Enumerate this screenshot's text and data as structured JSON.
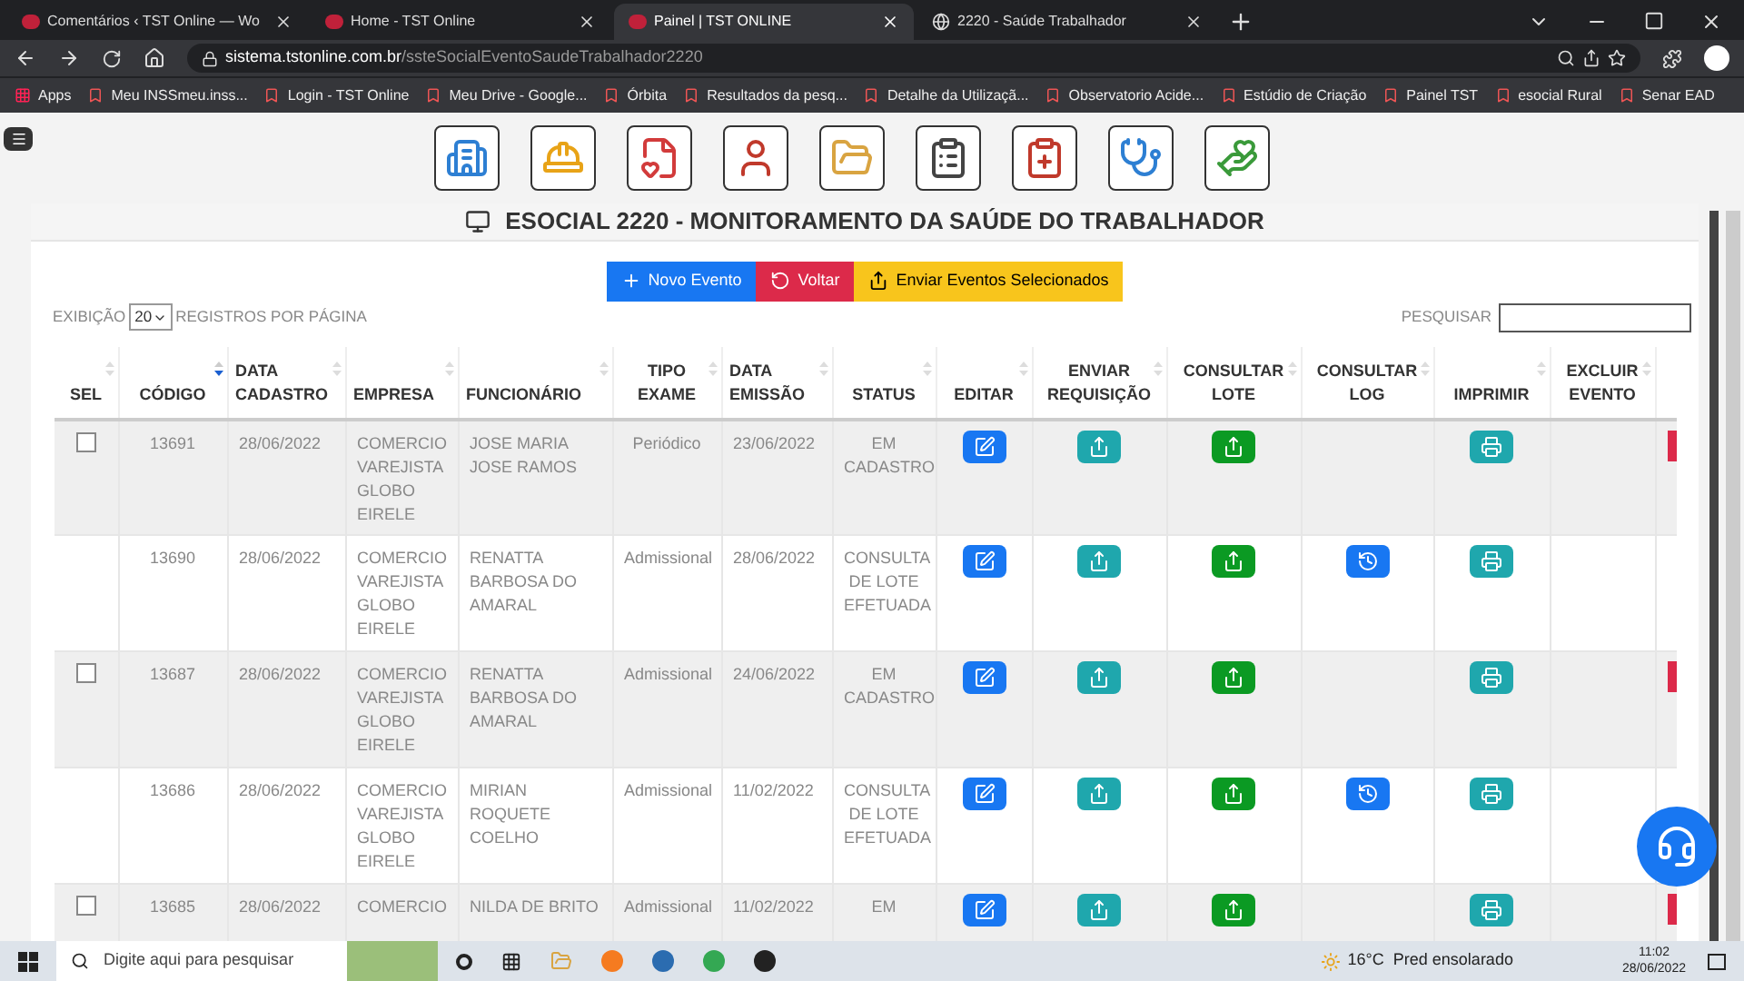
{
  "browser": {
    "tabs": [
      {
        "title": "Comentários ‹ TST Online — Wo",
        "selected": false
      },
      {
        "title": "Home - TST Online",
        "selected": false
      },
      {
        "title": "Painel | TST ONLINE",
        "selected": true
      },
      {
        "title": "2220 - Saúde Trabalhador",
        "selected": false
      }
    ],
    "url": {
      "host": "sistema.tstonline.com.br",
      "path": "/ssteSocialEventoSaudeTrabalhador2220"
    },
    "bookmarks": [
      "Apps",
      "Meu INSSmeu.inss...",
      "Login - TST Online",
      "Meu Drive - Google...",
      "Órbita",
      "Resultados da pesq...",
      "Detalhe da Utilizaçã...",
      "Observatorio Acide...",
      "Estúdio de Criação",
      "Painel TST",
      "esocial Rural",
      "Senar EAD"
    ]
  },
  "page": {
    "title": "ESOCIAL 2220 - MONITORAMENTO DA SAÚDE DO TRABALHADOR",
    "actions": [
      {
        "kind": "new",
        "label": "Novo Evento"
      },
      {
        "kind": "back",
        "label": "Voltar"
      },
      {
        "kind": "send",
        "label": "Enviar Eventos Selecionados"
      }
    ],
    "page_size": {
      "before": "EXIBIÇÃO",
      "value": "20",
      "after": "REGISTROS POR PÁGINA"
    },
    "search": {
      "label": "PESQUISAR"
    }
  },
  "table": {
    "columns": [
      {
        "label": "SEL",
        "sorted": false
      },
      {
        "label": "CÓDIGO",
        "sorted": true
      },
      {
        "label": "DATA CADASTRO",
        "sorted": false
      },
      {
        "label": "EMPRESA",
        "sorted": false
      },
      {
        "label": "FUNCIONÁRIO",
        "sorted": false
      },
      {
        "label": "TIPO EXAME",
        "sorted": false
      },
      {
        "label": "DATA EMISSÃO",
        "sorted": false
      },
      {
        "label": "STATUS",
        "sorted": false
      },
      {
        "label": "EDITAR",
        "sorted": false
      },
      {
        "label": "ENVIAR REQUISIÇÃO",
        "sorted": false
      },
      {
        "label": "CONSULTAR LOTE",
        "sorted": false
      },
      {
        "label": "CONSULTAR LOG",
        "sorted": false
      },
      {
        "label": "IMPRIMIR",
        "sorted": false
      },
      {
        "label": "EXCLUIR EVENTO",
        "sorted": false
      }
    ],
    "rows": [
      {
        "selectable": true,
        "checked": false,
        "code": "13691",
        "registered": "28/06/2022",
        "company": "COMERCIO VAREJISTA GLOBO EIRELE",
        "employee": "JOSE MARIA JOSE RAMOS",
        "exam_type": "Periódico",
        "issued": "23/06/2022",
        "status": "EM CADASTRO",
        "log": false,
        "delete": true
      },
      {
        "selectable": false,
        "code": "13690",
        "registered": "28/06/2022",
        "company": "COMERCIO VAREJISTA GLOBO EIRELE",
        "employee": "RENATTA BARBOSA DO AMARAL",
        "exam_type": "Admissional",
        "issued": "28/06/2022",
        "status": "CONSULTA DE LOTE EFETUADA",
        "log": true,
        "delete": false
      },
      {
        "selectable": true,
        "checked": false,
        "code": "13687",
        "registered": "28/06/2022",
        "company": "COMERCIO VAREJISTA GLOBO EIRELE",
        "employee": "RENATTA BARBOSA DO AMARAL",
        "exam_type": "Admissional",
        "issued": "24/06/2022",
        "status": "EM CADASTRO",
        "log": false,
        "delete": true
      },
      {
        "selectable": false,
        "code": "13686",
        "registered": "28/06/2022",
        "company": "COMERCIO VAREJISTA GLOBO EIRELE",
        "employee": "MIRIAN ROQUETE COELHO",
        "exam_type": "Admissional",
        "issued": "11/02/2022",
        "status": "CONSULTA DE LOTE EFETUADA",
        "log": true,
        "delete": false
      },
      {
        "selectable": true,
        "checked": false,
        "code": "13685",
        "registered": "28/06/2022",
        "company": "COMERCIO",
        "employee": "NILDA DE BRITO",
        "exam_type": "Admissional",
        "issued": "11/02/2022",
        "status": "EM",
        "log": false,
        "delete": true
      }
    ]
  },
  "taskbar": {
    "search": {
      "placeholder": "Digite aqui para pesquisar"
    },
    "weather": "16°C  Pred ensolarado",
    "time": "11:02",
    "date": "28/06/2022"
  }
}
